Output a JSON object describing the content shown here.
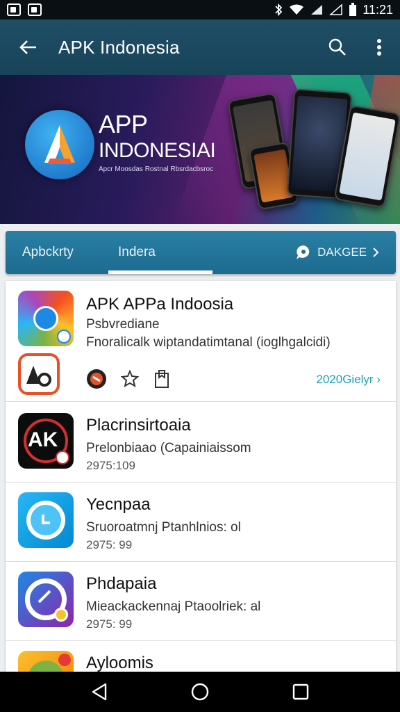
{
  "status_bar": {
    "time": "11:21"
  },
  "app_bar": {
    "title": "APK Indonesia"
  },
  "banner": {
    "title_line1": "APP",
    "title_line2": "INDONESIAI",
    "subtitle": "Apcr Moosdas Rostnal Rbsrdacbsroc",
    "colors": {
      "bg_start": "#14163e",
      "bg_end": "#2d8a52"
    }
  },
  "tabs": {
    "items": [
      {
        "label": "Apbckrty"
      },
      {
        "label": "Indera"
      }
    ],
    "action_label": "DAKGEE",
    "active_index": 1,
    "accent": "#1d6b8f"
  },
  "featured": {
    "title": "APK APPa Indoosia",
    "subtitle": "Psbvrediane",
    "description": "Fnoralicalk wiptandatimtanal (ioglhgalcidi)",
    "more_link": "2020Gielyr"
  },
  "apps": [
    {
      "title": "Placrinsirtoaia",
      "subtitle": "Prelonbiaao (Capainiaissom",
      "meta": "2975:109"
    },
    {
      "title": "Yecnpaa",
      "subtitle": "Sruoroatmnj Ptanhlnios: ol",
      "meta": "2975: 99"
    },
    {
      "title": "Phdapaia",
      "subtitle": "Mieackackennaj Ptaoolriek: al",
      "meta": "2975: 99"
    },
    {
      "title": "Ayloomis",
      "subtitle": "",
      "meta": ""
    }
  ],
  "icons": {
    "back": "arrow-back-icon",
    "search": "search-icon",
    "overflow": "more-vert-icon",
    "tab_action": "chat-bubble-icon",
    "featured_actions": [
      "app-badge-icon",
      "puzzle-icon",
      "bookmark-icon"
    ]
  }
}
